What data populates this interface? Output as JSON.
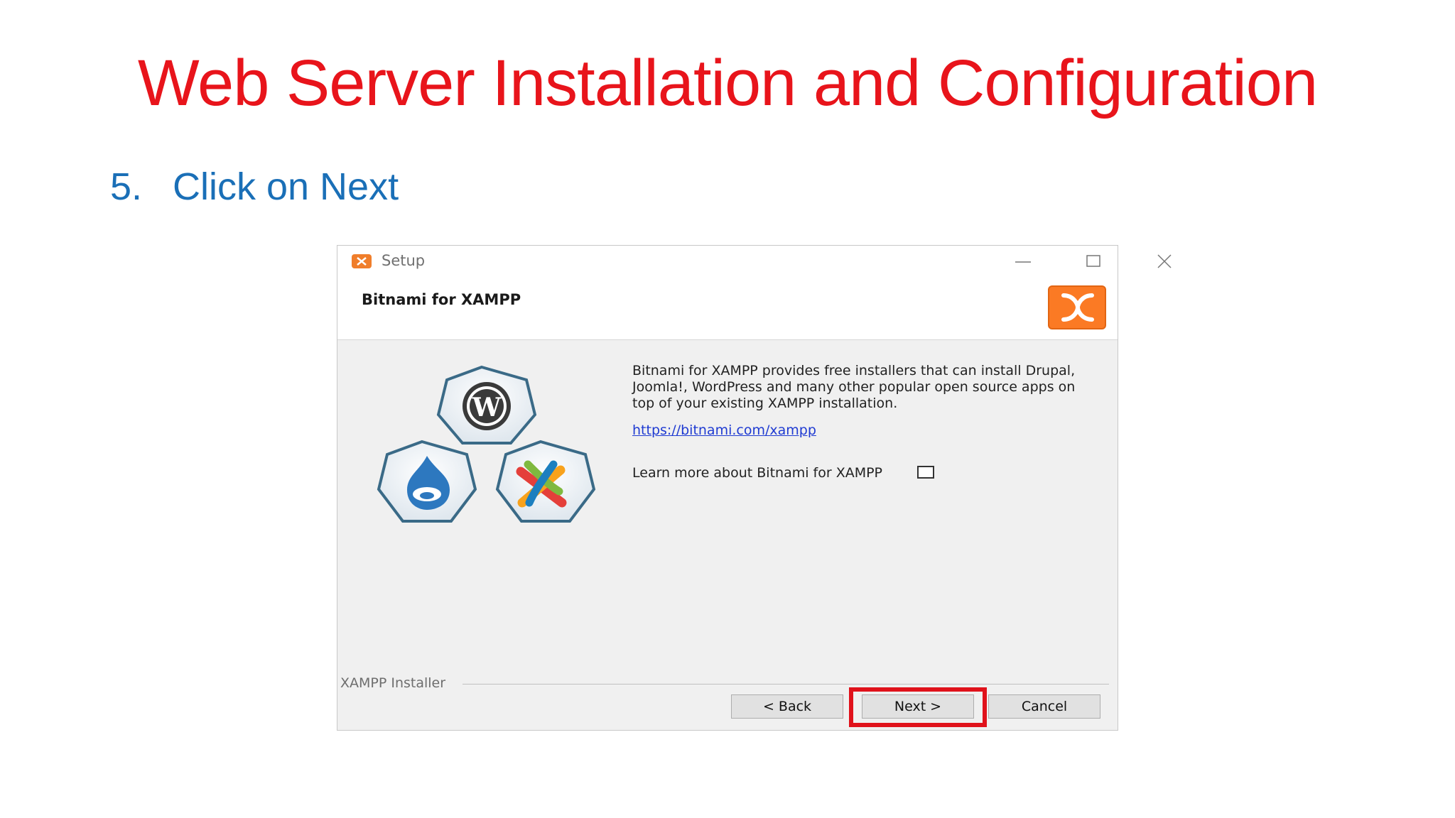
{
  "slide": {
    "title": "Web Server Installation and Configuration",
    "step_number": "5.",
    "step_text": "Click on Next"
  },
  "dialog": {
    "title": "Setup",
    "header_title": "Bitnami for XAMPP",
    "description": "Bitnami for XAMPP provides free installers that can install Drupal, Joomla!, WordPress and many other popular open source apps on top of your existing XAMPP installation.",
    "link": "https://bitnami.com/xampp",
    "learn_more_label": "Learn more about Bitnami for XAMPP",
    "learn_more_checked": false,
    "group_label": "XAMPP Installer",
    "buttons": {
      "back": "< Back",
      "next": "Next >",
      "cancel": "Cancel"
    },
    "icons": [
      "xampp-icon",
      "minimize-icon",
      "maximize-icon",
      "close-icon",
      "xampp-logo-icon",
      "wordpress-icon",
      "drupal-icon",
      "joomla-icon"
    ]
  },
  "colors": {
    "title_red": "#e8141b",
    "step_blue": "#1a6fb7",
    "xampp_orange": "#fb7a24",
    "highlight_red": "#e0121b",
    "link_blue": "#1f3bd2"
  }
}
